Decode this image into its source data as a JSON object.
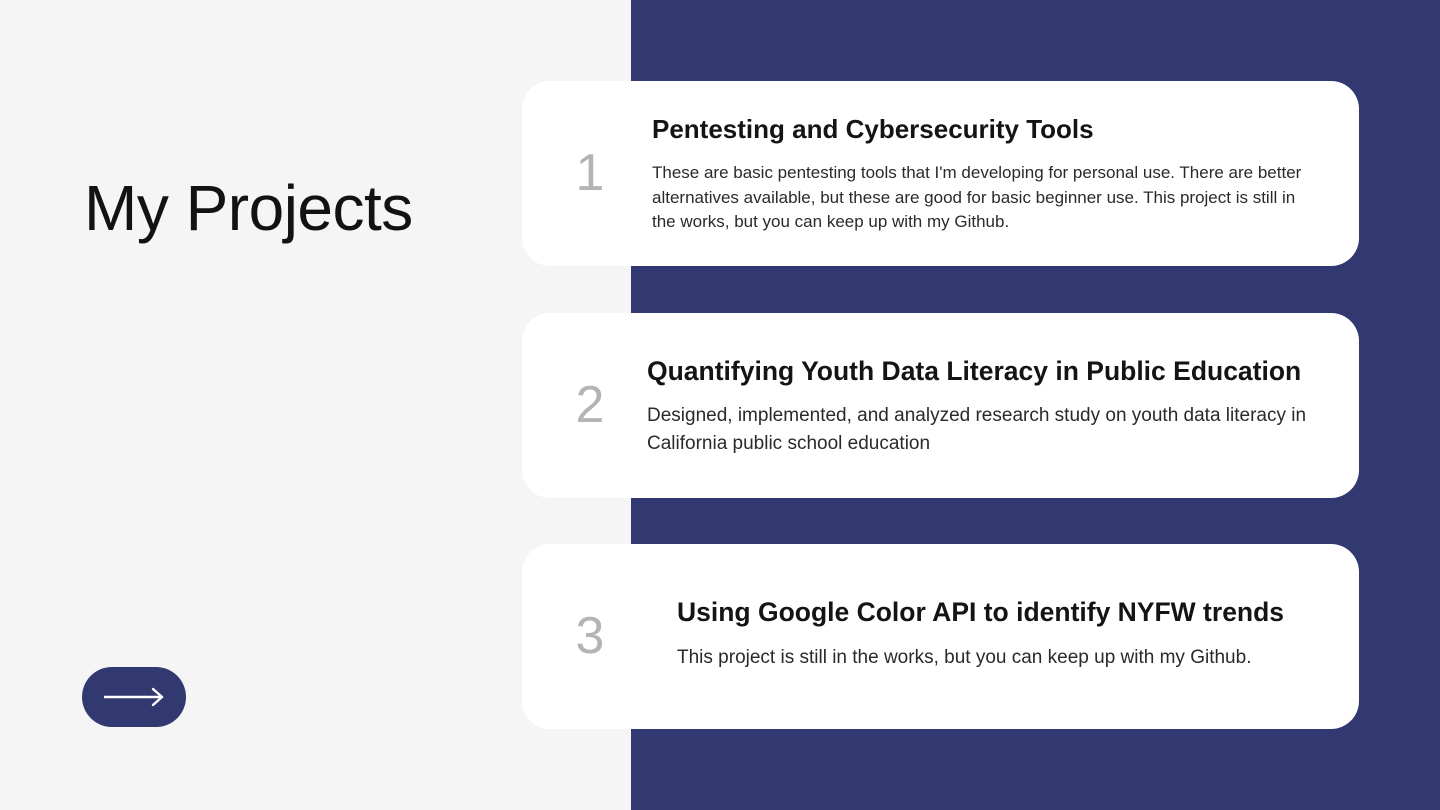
{
  "page": {
    "title": "My Projects"
  },
  "theme": {
    "background": "#f5f5f5",
    "panel": "#313970",
    "card": "#ffffff",
    "number": "#b4b4b4",
    "text": "#141414"
  },
  "navigation": {
    "next_icon": "arrow-right-icon"
  },
  "projects": [
    {
      "number": "1",
      "title": "Pentesting and Cybersecurity Tools",
      "description": "These are basic pentesting tools that I'm developing for personal use. There are better alternatives available, but these are good for basic beginner use. This project is still in the works, but you can keep up with my Github."
    },
    {
      "number": "2",
      "title": "Quantifying Youth Data Literacy in Public Education",
      "description": "Designed, implemented, and analyzed research study on youth data literacy in California public school education"
    },
    {
      "number": "3",
      "title": "Using Google Color API to identify NYFW trends",
      "description": "This project is still in the works, but you can keep up with my Github."
    }
  ]
}
